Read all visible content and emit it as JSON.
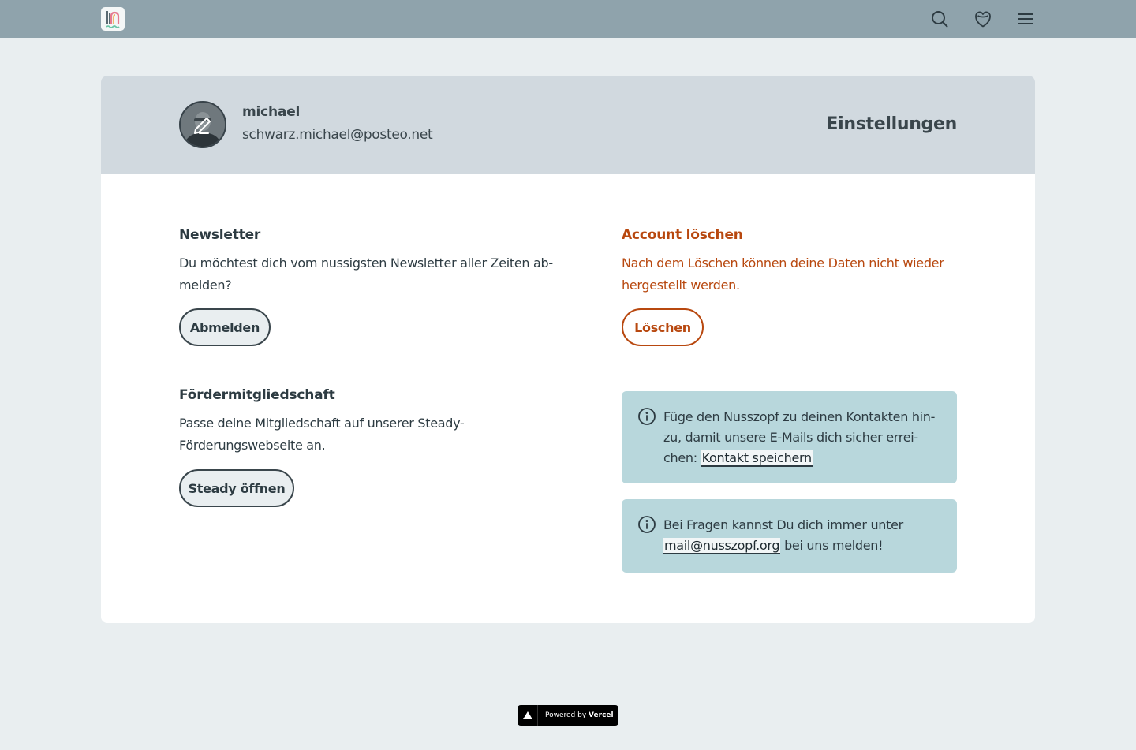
{
  "nav": {
    "logo_alt": "Nusszopf",
    "icons": [
      "search-icon",
      "heart-icon",
      "menu-icon"
    ]
  },
  "profile": {
    "name": "michael",
    "email": "schwarz.michael@posteo.net",
    "page_title": "Einstellungen"
  },
  "newsletter": {
    "title": "Newsletter",
    "text_line1": "Du möchtest dich vom nussigsten Newsletter aller Zeiten ab-",
    "text_line2": "melden?",
    "button": "Abmelden"
  },
  "membership": {
    "title": "Fördermitgliedschaft",
    "text_line1": "Passe deine Mitgliedschaft auf unserer Steady-",
    "text_line2": "Förderungswebseite an.",
    "button": "Steady öffnen"
  },
  "delete_account": {
    "title": "Account löschen",
    "text_line1": "Nach dem Löschen können deine Daten nicht wieder",
    "text_line2": "hergestellt werden.",
    "button": "Löschen"
  },
  "info_contact": {
    "line1": "Füge den Nusszopf zu deinen Kontakten hin-",
    "line2": "zu, damit unsere E-Mails dich sicher errei-",
    "line3_prefix": "chen: ",
    "link": "Kontakt speichern"
  },
  "info_questions": {
    "line1": "Bei Fragen kannst Du dich immer unter",
    "link": "mail@nusszopf.org",
    "line2_suffix": " bei uns melden!"
  },
  "footer": {
    "powered_by": "Powered by",
    "vercel": "Vercel"
  },
  "colors": {
    "topbar": "#8fa3ac",
    "page_bg": "#e9eef0",
    "header_bg": "#d1d9df",
    "danger": "#b8480f",
    "info_bg": "#b8d7dc"
  }
}
